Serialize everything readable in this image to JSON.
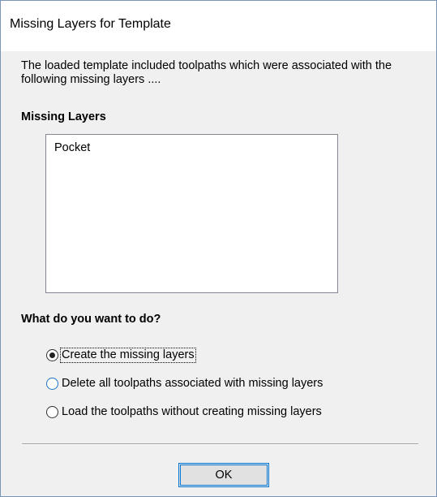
{
  "window": {
    "title": "Missing Layers for Template"
  },
  "intro_text": "The loaded template included toolpaths which were associated with the following missing layers ....",
  "missing_layers": {
    "label": "Missing Layers",
    "items": [
      "Pocket"
    ]
  },
  "action": {
    "label": "What do you want to do?",
    "options": [
      {
        "label": "Create the missing layers",
        "selected": true
      },
      {
        "label": "Delete all toolpaths associated with missing layers",
        "selected": false
      },
      {
        "label": "Load the toolpaths without creating missing layers",
        "selected": false
      }
    ]
  },
  "buttons": {
    "ok_label": "OK"
  },
  "colors": {
    "focus_border": "#0078d7",
    "titlebar_bg": "#ffffff",
    "dialog_bg": "#f0f0f0"
  }
}
